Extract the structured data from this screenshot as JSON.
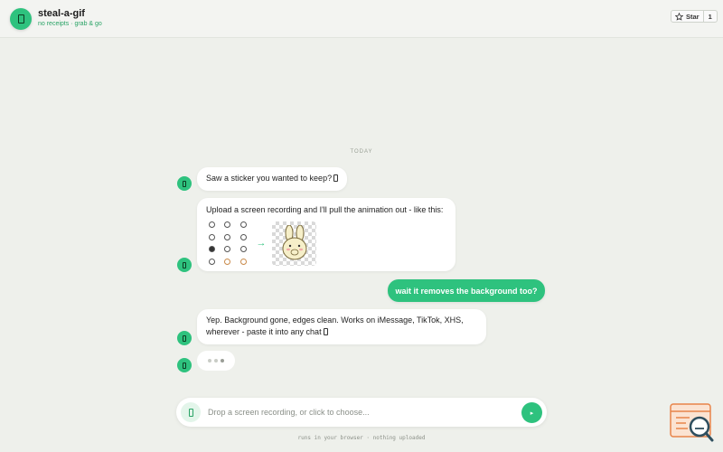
{
  "header": {
    "app_title": "steal-a-gif",
    "app_subtitle": "no receipts · grab & go",
    "star_label": "Star",
    "star_count": "1"
  },
  "chat": {
    "day_label": "TODAY",
    "messages": [
      {
        "from": "bot",
        "text": "Saw a sticker you wanted to keep?"
      },
      {
        "from": "bot",
        "text": "Upload a screen recording and I'll pull the animation out - like this:",
        "demo": {
          "arrow": "→"
        }
      },
      {
        "from": "user",
        "text": "wait it removes the background too?"
      },
      {
        "from": "bot",
        "text_line1": "Yep. Background gone, edges clean. Works on iMessage, TikTok, XHS,",
        "text_line2": "wherever - paste it into any chat"
      }
    ]
  },
  "composer": {
    "placeholder": "Drop a screen recording, or click to choose...",
    "send_icon": "▸"
  },
  "footer": {
    "note": "runs in your browser · nothing uploaded"
  },
  "colors": {
    "accent": "#2ec27e",
    "background": "#eef0eb",
    "subtitle": "#2aa366"
  },
  "icons": [
    "logo-icon",
    "star-icon",
    "bot-avatar-icon",
    "upload-icon",
    "send-icon",
    "help-widget-icon"
  ]
}
